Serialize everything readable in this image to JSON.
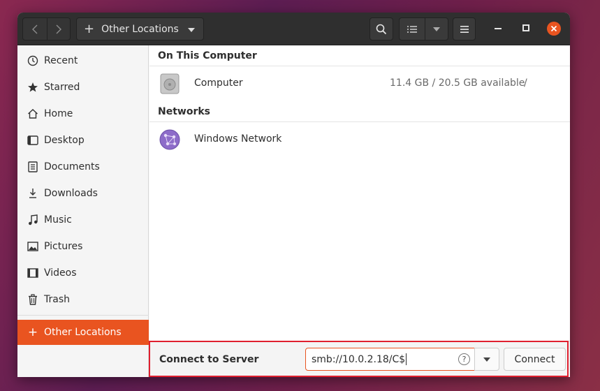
{
  "window": {
    "location_button_label": "Other Locations"
  },
  "sidebar": {
    "items": [
      {
        "label": "Recent",
        "icon": "clock-icon"
      },
      {
        "label": "Starred",
        "icon": "star-icon"
      },
      {
        "label": "Home",
        "icon": "home-icon"
      },
      {
        "label": "Desktop",
        "icon": "desktop-icon"
      },
      {
        "label": "Documents",
        "icon": "document-icon"
      },
      {
        "label": "Downloads",
        "icon": "download-icon"
      },
      {
        "label": "Music",
        "icon": "music-icon"
      },
      {
        "label": "Pictures",
        "icon": "picture-icon"
      },
      {
        "label": "Videos",
        "icon": "video-icon"
      },
      {
        "label": "Trash",
        "icon": "trash-icon"
      }
    ],
    "active": {
      "label": "Other Locations",
      "icon": "plus-icon"
    }
  },
  "main": {
    "on_this_computer_header": "On This Computer",
    "computer": {
      "name": "Computer",
      "info": "11.4 GB / 20.5 GB available",
      "path": "/"
    },
    "networks_header": "Networks",
    "windows_network": {
      "name": "Windows Network"
    }
  },
  "connect_bar": {
    "label": "Connect to Server",
    "address": "smb://10.0.2.18/C$",
    "help_glyph": "?",
    "connect_label": "Connect"
  },
  "colors": {
    "accent": "#e95420",
    "headerbar": "#2f2f2f",
    "highlight": "#e0202f"
  }
}
